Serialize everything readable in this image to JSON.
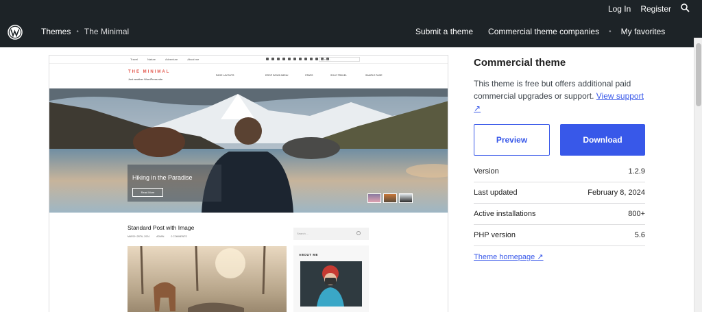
{
  "topbar": {
    "login": "Log In",
    "register": "Register",
    "breadcrumb": {
      "themes": "Themes",
      "current": "The Minimal"
    },
    "nav": {
      "submit": "Submit a theme",
      "commercial": "Commercial theme companies",
      "favorites": "My favorites"
    }
  },
  "preview": {
    "topmenu": [
      "Travel",
      "Nature",
      "Adventure",
      "About me"
    ],
    "search_placeholder": "Search ...",
    "brand": "THE MINIMAL",
    "tagline": "Just another WordPress site",
    "menu": [
      "PAGE LAYOUTS",
      "DROP DOWN MENU",
      "STARS",
      "SOLO TRAVEL",
      "SAMPLE PAGE"
    ],
    "hero_title": "Hiking in the Paradise",
    "hero_button": "Read More",
    "post_title": "Standard Post with Image",
    "post_meta": {
      "date": "MARCH 28TH, 2024",
      "author": "ADMIN",
      "comments": "0 COMMENTS"
    },
    "sidebar_search": "Search ...",
    "about_title": "ABOUT ME"
  },
  "panel": {
    "title": "Commercial theme",
    "desc": "This theme is free but offers additional paid commercial upgrades or support.",
    "support_link": "View support ↗",
    "preview_btn": "Preview",
    "download_btn": "Download",
    "meta": [
      {
        "label": "Version",
        "value": "1.2.9"
      },
      {
        "label": "Last updated",
        "value": "February 8, 2024"
      },
      {
        "label": "Active installations",
        "value": "800+"
      },
      {
        "label": "PHP version",
        "value": "5.6"
      }
    ],
    "homepage_link": "Theme homepage ↗"
  },
  "colors": {
    "accent": "#3858e9",
    "topbar": "#1d2327"
  }
}
